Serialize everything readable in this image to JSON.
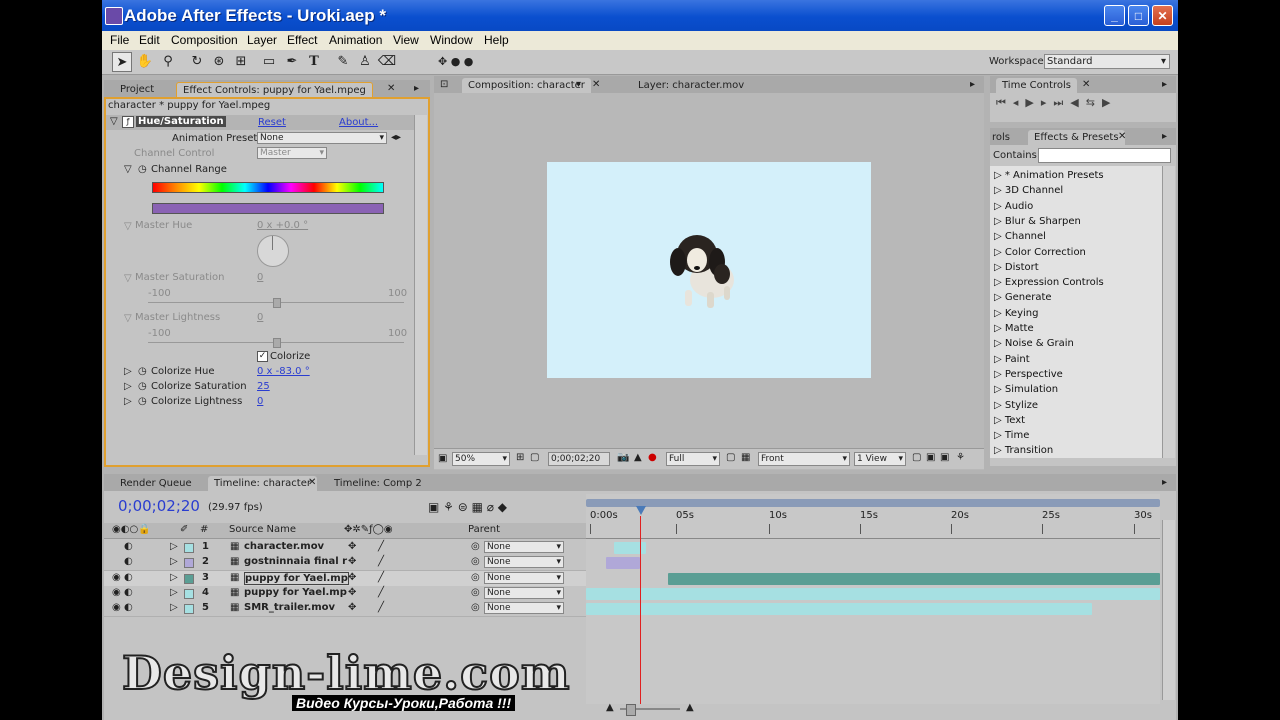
{
  "app": {
    "title": "Adobe After Effects - Uroki.aep *",
    "window_controls": {
      "minimize": "_",
      "maximize": "□",
      "close": "✕"
    }
  },
  "menu": [
    "File",
    "Edit",
    "Composition",
    "Layer",
    "Effect",
    "Animation",
    "View",
    "Window",
    "Help"
  ],
  "workspace": {
    "label": "Workspace:",
    "value": "Standard"
  },
  "project_panel": {
    "tabs": {
      "project": "Project",
      "effect_controls": "Effect Controls: puppy for Yael.mpeg"
    },
    "subtitle": "character * puppy for Yael.mpeg",
    "effect": {
      "name": "Hue/Saturation",
      "reset": "Reset",
      "about": "About...",
      "animation_presets_label": "Animation Presets:",
      "animation_presets_value": "None",
      "channel_control_label": "Channel Control",
      "channel_control_value": "Master",
      "channel_range_label": "Channel Range",
      "master_hue_label": "Master Hue",
      "master_hue_value": "0 x +0.0 °",
      "master_saturation_label": "Master Saturation",
      "master_saturation_value": "0",
      "master_lightness_label": "Master Lightness",
      "master_lightness_value": "0",
      "slider_min": "-100",
      "slider_max": "100",
      "colorize_label": "Colorize",
      "colorize_hue_label": "Colorize Hue",
      "colorize_hue_value": "0 x -83.0 °",
      "colorize_saturation_label": "Colorize Saturation",
      "colorize_saturation_value": "25",
      "colorize_lightness_label": "Colorize Lightness",
      "colorize_lightness_value": "0"
    }
  },
  "composition_panel": {
    "tabs": {
      "comp": "Composition: character",
      "layer": "Layer: character.mov"
    },
    "zoom": "50%",
    "timecode": "0;00;02;20",
    "resolution": "Full",
    "view": "Front",
    "views": "1 View",
    "canvas_bg": "#d4f0fa"
  },
  "time_controls": {
    "title": "Time Controls"
  },
  "effects_presets": {
    "tab_left": "rols",
    "title": "Effects & Presets",
    "contains_label": "Contains:",
    "items": [
      "* Animation Presets",
      "3D Channel",
      "Audio",
      "Blur & Sharpen",
      "Channel",
      "Color Correction",
      "Distort",
      "Expression Controls",
      "Generate",
      "Keying",
      "Matte",
      "Noise & Grain",
      "Paint",
      "Perspective",
      "Simulation",
      "Stylize",
      "Text",
      "Time",
      "Transition"
    ]
  },
  "timeline": {
    "tabs": {
      "render_queue": "Render Queue",
      "timeline_character": "Timeline: character",
      "timeline_comp2": "Timeline: Comp 2"
    },
    "timecode": "0;00;02;20",
    "fps": "(29.97 fps)",
    "columns": {
      "hash": "#",
      "source_name": "Source Name",
      "parent": "Parent"
    },
    "ruler": [
      "0:00s",
      "05s",
      "10s",
      "15s",
      "20s",
      "25s",
      "30s"
    ],
    "layers": [
      {
        "num": "1",
        "name": "character.mov",
        "parent": "None",
        "color": "#a6e0e2"
      },
      {
        "num": "2",
        "name": "gostninnaia final r",
        "parent": "None",
        "color": "#b0a8d8"
      },
      {
        "num": "3",
        "name": "puppy for Yael.mp",
        "parent": "None",
        "color": "#5a9e94"
      },
      {
        "num": "4",
        "name": "puppy for Yael.mp",
        "parent": "None",
        "color": "#a6e0e2"
      },
      {
        "num": "5",
        "name": "SMR_trailer.mov",
        "parent": "None",
        "color": "#a6e0e2"
      }
    ]
  },
  "watermark": {
    "logo": "Design-lime.com",
    "tagline": "Видео Курсы-Уроки,Работа !!!"
  }
}
